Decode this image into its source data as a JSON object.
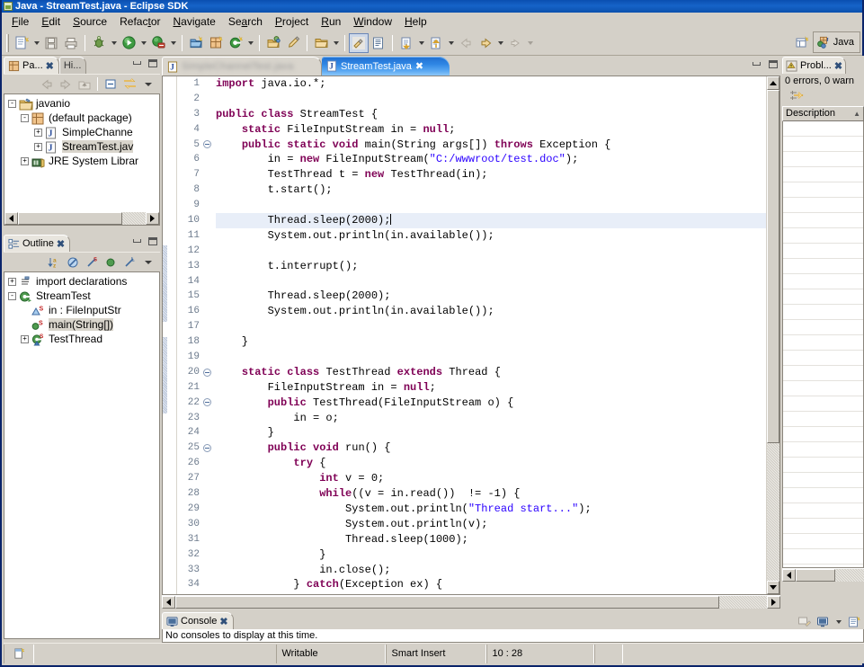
{
  "window": {
    "title": "Java - StreamTest.java - Eclipse SDK",
    "icon": "eclipse-icon"
  },
  "menubar": {
    "items": [
      {
        "label": "File"
      },
      {
        "label": "Edit"
      },
      {
        "label": "Source"
      },
      {
        "label": "Refactor"
      },
      {
        "label": "Navigate"
      },
      {
        "label": "Search"
      },
      {
        "label": "Project"
      },
      {
        "label": "Run"
      },
      {
        "label": "Window"
      },
      {
        "label": "Help"
      }
    ]
  },
  "toolbar": {
    "buttons": [
      "new-wizard",
      "save",
      "print",
      "debug",
      "run",
      "run-external-tools",
      "new-java-project",
      "new-package",
      "new-class",
      "open-type",
      "search",
      "open-resource",
      "toggle-mark-occurrences",
      "show-whitespace",
      "next-annotation",
      "previous-annotation",
      "back",
      "forward",
      "next-edit"
    ],
    "perspective_button": "Java",
    "open-perspective": "open-perspective-icon"
  },
  "package_explorer": {
    "tabs": [
      {
        "label": "Pa...",
        "active": true,
        "icon": "package-explorer-icon"
      },
      {
        "label": "Hi...",
        "active": false,
        "icon": "hierarchy-icon"
      }
    ],
    "toolbar": [
      "back-icon",
      "forward-icon",
      "up-icon",
      "collapse-all-icon",
      "link-with-editor-icon",
      "view-menu-icon"
    ],
    "tree": [
      {
        "indent": 0,
        "expander": "-",
        "icon": "project-folder-icon",
        "label": "javanio",
        "selected": false
      },
      {
        "indent": 1,
        "expander": "-",
        "icon": "package-icon",
        "label": "(default package)",
        "selected": false
      },
      {
        "indent": 2,
        "expander": "+",
        "icon": "java-file-icon",
        "label": "SimpleChanne",
        "selected": false
      },
      {
        "indent": 2,
        "expander": "+",
        "icon": "java-file-icon",
        "label": "StreamTest.jav",
        "selected": true
      },
      {
        "indent": 1,
        "expander": "+",
        "icon": "jre-library-icon",
        "label": "JRE System Librar",
        "selected": false
      }
    ]
  },
  "outline": {
    "tab": {
      "label": "Outline",
      "icon": "outline-icon"
    },
    "toolbar": [
      "sort-icon",
      "hide-fields-icon",
      "hide-static-icon",
      "hide-non-public-icon",
      "hide-local-types-icon",
      "view-menu-icon"
    ],
    "tree": [
      {
        "indent": 0,
        "expander": "+",
        "icon": "import-declarations-icon",
        "label": "import declarations",
        "selected": false
      },
      {
        "indent": 0,
        "expander": "-",
        "icon": "class-icon",
        "label": "StreamTest",
        "selected": false
      },
      {
        "indent": 1,
        "expander": "",
        "icon": "field-icon",
        "label": "in : FileInputStr",
        "selected": false,
        "static": true
      },
      {
        "indent": 1,
        "expander": "",
        "icon": "method-icon",
        "label": "main(String[])",
        "selected": true,
        "static": true
      },
      {
        "indent": 1,
        "expander": "+",
        "icon": "class-icon",
        "label": "TestThread",
        "selected": false,
        "static": true
      }
    ]
  },
  "editor": {
    "tabs": [
      {
        "label": "SimpleChannelTest.java",
        "active": false,
        "blurred": true,
        "icon": "java-file-icon"
      },
      {
        "label": "StreamTest.java",
        "active": true,
        "blurred": false,
        "icon": "java-file-icon",
        "close": "✖"
      }
    ],
    "current_line": 10,
    "folds": [
      5,
      20,
      22,
      25
    ],
    "lines": [
      {
        "n": 1,
        "tokens": [
          {
            "t": "import",
            "c": "kw"
          },
          {
            "t": " java.io.*;",
            "c": ""
          }
        ]
      },
      {
        "n": 2,
        "tokens": []
      },
      {
        "n": 3,
        "tokens": [
          {
            "t": "public",
            "c": "kw"
          },
          {
            "t": " ",
            "c": ""
          },
          {
            "t": "class",
            "c": "kw"
          },
          {
            "t": " StreamTest {",
            "c": ""
          }
        ]
      },
      {
        "n": 4,
        "tokens": [
          {
            "t": "    ",
            "c": ""
          },
          {
            "t": "static",
            "c": "kw"
          },
          {
            "t": " FileInputStream in = ",
            "c": ""
          },
          {
            "t": "null",
            "c": "kw"
          },
          {
            "t": ";",
            "c": ""
          }
        ]
      },
      {
        "n": 5,
        "tokens": [
          {
            "t": "    ",
            "c": ""
          },
          {
            "t": "public",
            "c": "kw"
          },
          {
            "t": " ",
            "c": ""
          },
          {
            "t": "static",
            "c": "kw"
          },
          {
            "t": " ",
            "c": ""
          },
          {
            "t": "void",
            "c": "kw"
          },
          {
            "t": " main(String args[]) ",
            "c": ""
          },
          {
            "t": "throws",
            "c": "kw"
          },
          {
            "t": " Exception {",
            "c": ""
          }
        ]
      },
      {
        "n": 6,
        "tokens": [
          {
            "t": "        in = ",
            "c": ""
          },
          {
            "t": "new",
            "c": "kw"
          },
          {
            "t": " FileInputStream(",
            "c": ""
          },
          {
            "t": "\"C:/wwwroot/test.doc\"",
            "c": "str"
          },
          {
            "t": ");",
            "c": ""
          }
        ]
      },
      {
        "n": 7,
        "tokens": [
          {
            "t": "        TestThread t = ",
            "c": ""
          },
          {
            "t": "new",
            "c": "kw"
          },
          {
            "t": " TestThread(in);",
            "c": ""
          }
        ]
      },
      {
        "n": 8,
        "tokens": [
          {
            "t": "        t.start();",
            "c": ""
          }
        ]
      },
      {
        "n": 9,
        "tokens": []
      },
      {
        "n": 10,
        "tokens": [
          {
            "t": "        Thread.sleep(2000);",
            "c": ""
          }
        ],
        "caret": true
      },
      {
        "n": 11,
        "tokens": [
          {
            "t": "        System.out.println(in.available());",
            "c": ""
          }
        ]
      },
      {
        "n": 12,
        "tokens": []
      },
      {
        "n": 13,
        "tokens": [
          {
            "t": "        t.interrupt();",
            "c": ""
          }
        ]
      },
      {
        "n": 14,
        "tokens": []
      },
      {
        "n": 15,
        "tokens": [
          {
            "t": "        Thread.sleep(2000);",
            "c": ""
          }
        ]
      },
      {
        "n": 16,
        "tokens": [
          {
            "t": "        System.out.println(in.available());",
            "c": ""
          }
        ]
      },
      {
        "n": 17,
        "tokens": []
      },
      {
        "n": 18,
        "tokens": [
          {
            "t": "    }",
            "c": ""
          }
        ]
      },
      {
        "n": 19,
        "tokens": []
      },
      {
        "n": 20,
        "tokens": [
          {
            "t": "    ",
            "c": ""
          },
          {
            "t": "static",
            "c": "kw"
          },
          {
            "t": " ",
            "c": ""
          },
          {
            "t": "class",
            "c": "kw"
          },
          {
            "t": " TestThread ",
            "c": ""
          },
          {
            "t": "extends",
            "c": "kw"
          },
          {
            "t": " Thread {",
            "c": ""
          }
        ]
      },
      {
        "n": 21,
        "tokens": [
          {
            "t": "        FileInputStream in = ",
            "c": ""
          },
          {
            "t": "null",
            "c": "kw"
          },
          {
            "t": ";",
            "c": ""
          }
        ]
      },
      {
        "n": 22,
        "tokens": [
          {
            "t": "        ",
            "c": ""
          },
          {
            "t": "public",
            "c": "kw"
          },
          {
            "t": " TestThread(FileInputStream o) {",
            "c": ""
          }
        ]
      },
      {
        "n": 23,
        "tokens": [
          {
            "t": "            in = o;",
            "c": ""
          }
        ]
      },
      {
        "n": 24,
        "tokens": [
          {
            "t": "        }",
            "c": ""
          }
        ]
      },
      {
        "n": 25,
        "tokens": [
          {
            "t": "        ",
            "c": ""
          },
          {
            "t": "public",
            "c": "kw"
          },
          {
            "t": " ",
            "c": ""
          },
          {
            "t": "void",
            "c": "kw"
          },
          {
            "t": " run() {",
            "c": ""
          }
        ]
      },
      {
        "n": 26,
        "tokens": [
          {
            "t": "            ",
            "c": ""
          },
          {
            "t": "try",
            "c": "kw"
          },
          {
            "t": " {",
            "c": ""
          }
        ]
      },
      {
        "n": 27,
        "tokens": [
          {
            "t": "                ",
            "c": ""
          },
          {
            "t": "int",
            "c": "kw"
          },
          {
            "t": " v = 0;",
            "c": ""
          }
        ]
      },
      {
        "n": 28,
        "tokens": [
          {
            "t": "                ",
            "c": ""
          },
          {
            "t": "while",
            "c": "kw"
          },
          {
            "t": "((v = in.read())  != -1) {",
            "c": ""
          }
        ]
      },
      {
        "n": 29,
        "tokens": [
          {
            "t": "                    System.out.println(",
            "c": ""
          },
          {
            "t": "\"Thread start...\"",
            "c": "str"
          },
          {
            "t": ");",
            "c": ""
          }
        ]
      },
      {
        "n": 30,
        "tokens": [
          {
            "t": "                    System.out.println(v);",
            "c": ""
          }
        ]
      },
      {
        "n": 31,
        "tokens": [
          {
            "t": "                    Thread.sleep(1000);",
            "c": ""
          }
        ]
      },
      {
        "n": 32,
        "tokens": [
          {
            "t": "                }",
            "c": ""
          }
        ]
      },
      {
        "n": 33,
        "tokens": [
          {
            "t": "                in.close();",
            "c": ""
          }
        ]
      },
      {
        "n": 34,
        "tokens": [
          {
            "t": "            } ",
            "c": ""
          },
          {
            "t": "catch",
            "c": "kw"
          },
          {
            "t": "(Exception ex) {",
            "c": ""
          }
        ]
      }
    ]
  },
  "problems": {
    "tab": {
      "label": "Probl...",
      "icon": "problems-icon",
      "close": "✖"
    },
    "summary": "0 errors, 0 warn",
    "toolbar": [
      "filters-icon"
    ],
    "columns": [
      {
        "label": "Description",
        "sort": "▲"
      }
    ],
    "rows": []
  },
  "console": {
    "tab": {
      "label": "Console",
      "icon": "console-icon",
      "close": "✖"
    },
    "message": "No consoles to display at this time.",
    "toolbar": [
      "clear-console-icon",
      "display-selected-console-icon",
      "open-console-icon"
    ]
  },
  "statusbar": {
    "icon": "new-java-element-icon",
    "writable": "Writable",
    "insert_mode": "Smart Insert",
    "position": "10 : 28"
  },
  "colors": {
    "title_blue": "#0a4fb0",
    "tab_active_blue": "#2f86e4",
    "keyword": "#7f0055",
    "string": "#2a00ff",
    "chrome": "#d4d0c8",
    "line_number": "#6d7b8d",
    "current_line": "#e8eef8"
  }
}
